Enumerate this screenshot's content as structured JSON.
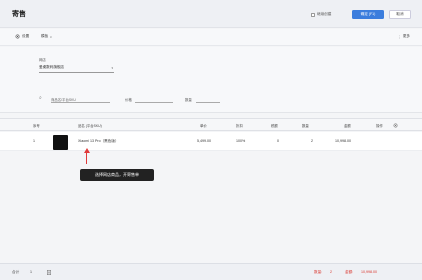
{
  "header": {
    "title": "寄售",
    "continue_label": "继续创建",
    "confirm_label": "确定 (F1)",
    "cancel_label": "取消"
  },
  "toolbar": {
    "settings_label": "设置",
    "template_label": "模板",
    "more_label": "更多"
  },
  "form": {
    "store_label": "网店",
    "store_value": "爱桌数码旗舰店",
    "product_placeholder": "商品名/平台SKU",
    "price_label": "价格",
    "quantity_label": "数量"
  },
  "table": {
    "headers": [
      "序号",
      "品名 (平台SKU)",
      "单价",
      "折扣",
      "税额",
      "数量",
      "金额",
      "操作"
    ],
    "rows": [
      {
        "index": "1",
        "name": "Xiaomi 13 Pro（黑色版）",
        "price": "5,499.00",
        "discount": "100%",
        "tax": "0",
        "quantity": "2",
        "amount": "10,998.00"
      }
    ]
  },
  "tooltip": "选择网店商品，开寄售单",
  "footer": {
    "total_label": "合计",
    "total_count": "1",
    "quantity_label": "数量:",
    "quantity_value": "2",
    "amount_label": "金额:",
    "amount_value": "10,998.00"
  }
}
